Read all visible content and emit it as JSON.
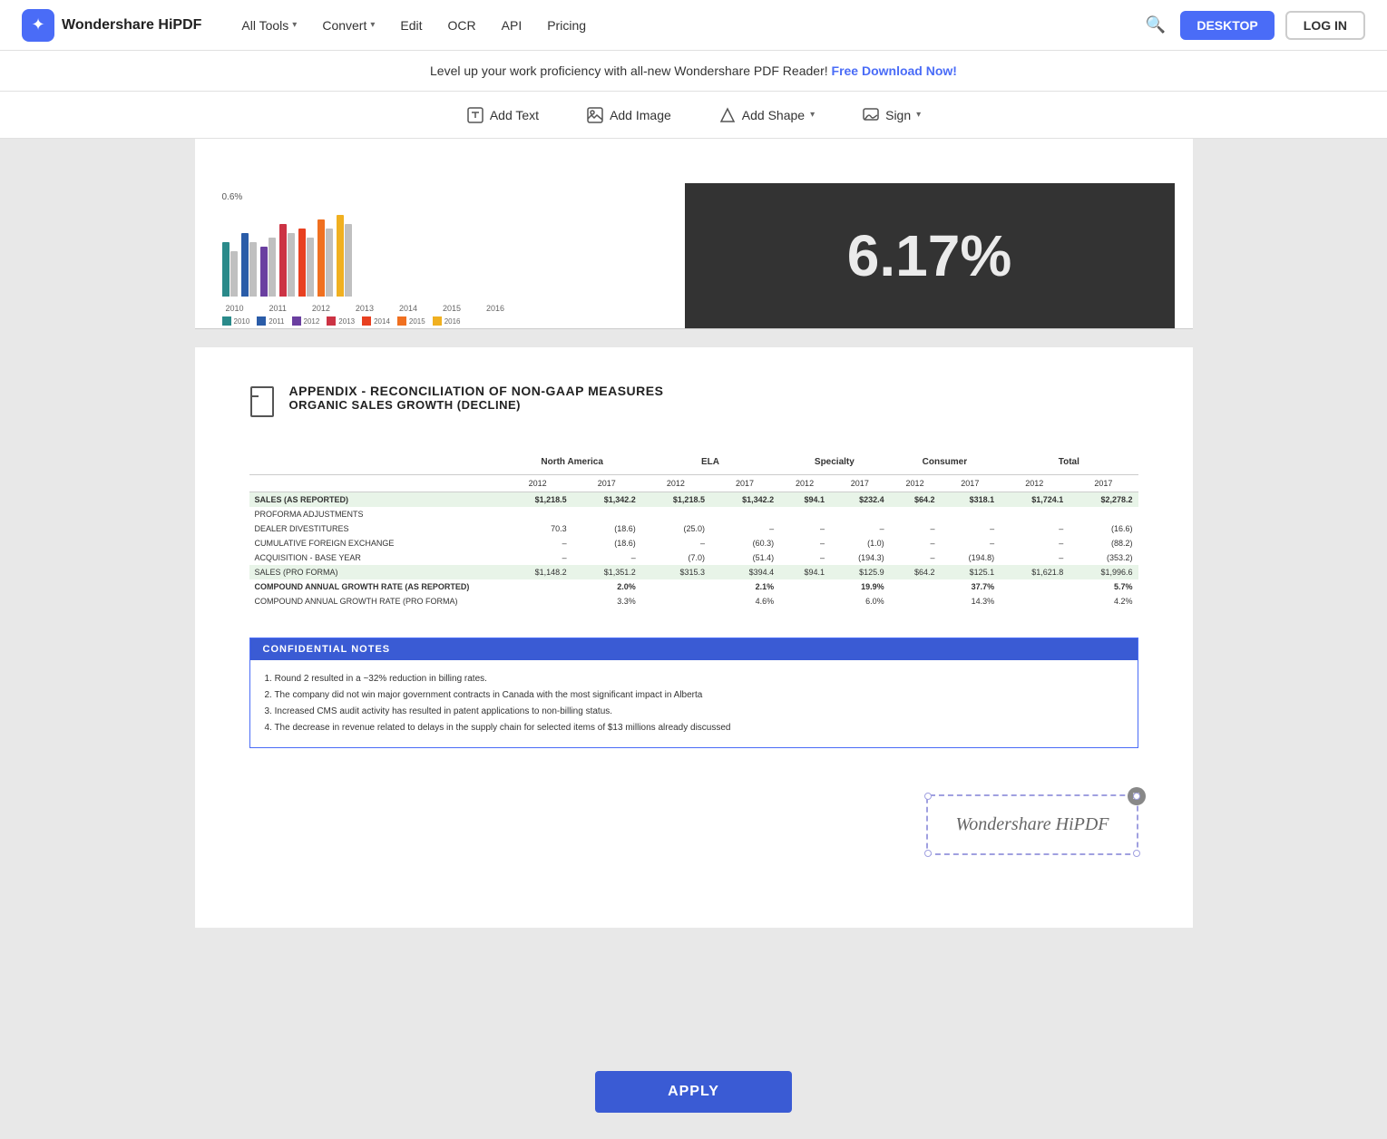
{
  "header": {
    "logo_text": "Wondershare HiPDF",
    "nav_items": [
      {
        "label": "All Tools",
        "has_dropdown": true
      },
      {
        "label": "Convert",
        "has_dropdown": true
      },
      {
        "label": "Edit",
        "has_dropdown": false
      },
      {
        "label": "OCR",
        "has_dropdown": false
      },
      {
        "label": "API",
        "has_dropdown": false
      },
      {
        "label": "Pricing",
        "has_dropdown": false
      }
    ],
    "btn_desktop": "DESKTOP",
    "btn_login": "LOG IN"
  },
  "banner": {
    "text": "Level up your work proficiency with all-new Wondershare PDF Reader!",
    "link_text": "Free Download Now!"
  },
  "toolbar": {
    "add_text_label": "Add Text",
    "add_image_label": "Add Image",
    "add_shape_label": "Add Shape",
    "sign_label": "Sign"
  },
  "chart": {
    "year_labels": [
      "2010",
      "2011",
      "2012",
      "2013",
      "2014",
      "2015",
      "2016"
    ],
    "colors": [
      "#2a8a8a",
      "#2a5ca8",
      "#6a3fa0",
      "#cc3344",
      "#e84020",
      "#f07020",
      "#f0b020"
    ]
  },
  "appendix": {
    "title1": "APPENDIX - RECONCILIATION OF NON-GAAP MEASURES",
    "title2": "ORGANIC SALES GROWTH (DECLINE)",
    "table": {
      "col_headers": [
        "",
        "",
        "North America",
        "",
        "ELA",
        "",
        "Specialty",
        "",
        "Consumer",
        "",
        "Total",
        ""
      ],
      "sub_headers": [
        "",
        "",
        "2012",
        "2017",
        "2012",
        "2017",
        "2012",
        "2017",
        "2012",
        "2017",
        "2012",
        "2017"
      ],
      "rows": [
        {
          "label": "SALES (AS REPORTED)",
          "values": [
            "$1,218.5",
            "$1,342.2",
            "$1,218.5",
            "$1,342.2",
            "$94.1",
            "$232.4",
            "$64.2",
            "$318.1",
            "$1,724.1",
            "$2,278.2"
          ],
          "style": "shaded bold"
        },
        {
          "label": "PROFORMA ADJUSTMENTS",
          "values": [
            "",
            "",
            "",
            "",
            "",
            "",
            "",
            "",
            "",
            ""
          ],
          "style": ""
        },
        {
          "label": "DEALER DIVESTITURES",
          "values": [
            "70.3",
            "(18.6)",
            "(25.0)",
            "–",
            "–",
            "–",
            "–",
            "–",
            "–",
            "(16.6)"
          ],
          "style": ""
        },
        {
          "label": "CUMULATIVE FOREIGN EXCHANGE",
          "values": [
            "–",
            "(18.6)",
            "–",
            "(60.3)",
            "–",
            "(1.0)",
            "–",
            "–",
            "–",
            "(88.2)"
          ],
          "style": ""
        },
        {
          "label": "ACQUISITION - BASE YEAR",
          "values": [
            "–",
            "–",
            "(7.0)",
            "(51.4)",
            "–",
            "(194.3)",
            "–",
            "(194.8)",
            "–",
            "(353.2)"
          ],
          "style": ""
        },
        {
          "label": "SALES (PRO FORMA)",
          "values": [
            "$1,148.2",
            "$1,351.2",
            "$315.3",
            "$394.4",
            "$94.1",
            "$125.9",
            "$64.2",
            "$125.1",
            "$1,621.8",
            "$1,996.6"
          ],
          "style": "shaded"
        },
        {
          "label": "COMPOUND ANNUAL GROWTH RATE (AS REPORTED)",
          "values": [
            "",
            "2.0%",
            "",
            "2.1%",
            "",
            "19.9%",
            "",
            "37.7%",
            "",
            "5.7%"
          ],
          "style": "bold"
        },
        {
          "label": "COMPOUND ANNUAL GROWTH RATE (PRO FORMA)",
          "values": [
            "",
            "3.3%",
            "",
            "4.6%",
            "",
            "6.0%",
            "",
            "14.3%",
            "",
            "4.2%"
          ],
          "style": ""
        }
      ]
    }
  },
  "confidential_notes": {
    "header": "CONFIDENTIAL NOTES",
    "notes": [
      "1.  Round 2 resulted in a ~32% reduction in billing rates.",
      "2.  The company did not win major government contracts in Canada with the most significant impact in Alberta",
      "3.  Increased CMS audit activity has resulted in patent applications to non-billing status.",
      "4.  The decrease in revenue related to delays in the supply chain for selected items of $13 millions already discussed"
    ]
  },
  "signature": {
    "text": "Wondershare HiPDF"
  },
  "apply_button": {
    "label": "APPLY"
  },
  "big_number": "6.17%"
}
